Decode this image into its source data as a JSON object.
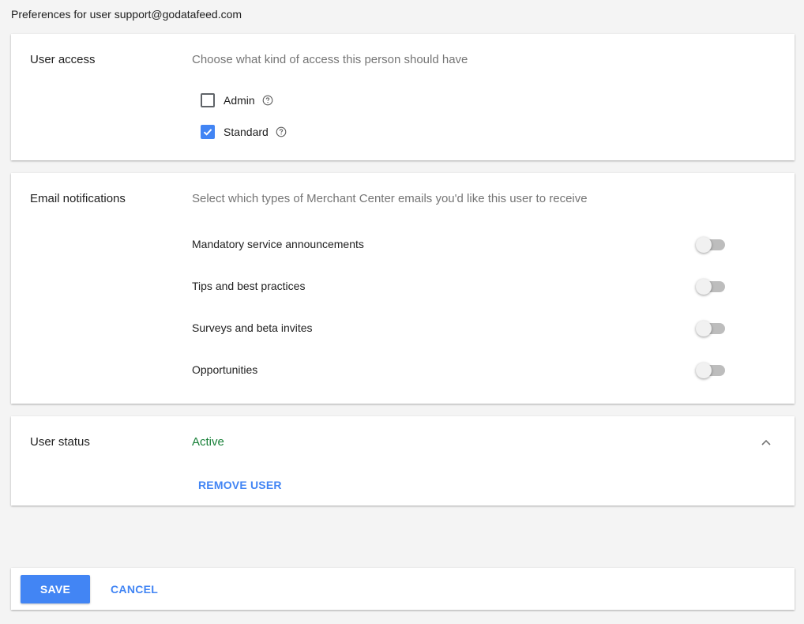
{
  "header": {
    "title": "Preferences for user support@godatafeed.com"
  },
  "user_access": {
    "label": "User access",
    "description": "Choose what kind of access this person should have",
    "options": [
      {
        "label": "Admin",
        "checked": false,
        "help_icon": "help-circle-icon"
      },
      {
        "label": "Standard",
        "checked": true,
        "help_icon": "help-circle-icon"
      }
    ]
  },
  "email_notifications": {
    "label": "Email notifications",
    "description": "Select which types of Merchant Center emails you'd like this user to receive",
    "items": [
      {
        "label": "Mandatory service announcements",
        "enabled": false
      },
      {
        "label": "Tips and best practices",
        "enabled": false
      },
      {
        "label": "Surveys and beta invites",
        "enabled": false
      },
      {
        "label": "Opportunities",
        "enabled": false
      }
    ]
  },
  "user_status": {
    "label": "User status",
    "value": "Active",
    "remove_label": "REMOVE USER",
    "expand_icon": "chevron-up-icon"
  },
  "footer": {
    "save_label": "SAVE",
    "cancel_label": "CANCEL"
  },
  "colors": {
    "accent": "#4285f4",
    "status_active": "#188038",
    "background": "#f4f4f4"
  }
}
